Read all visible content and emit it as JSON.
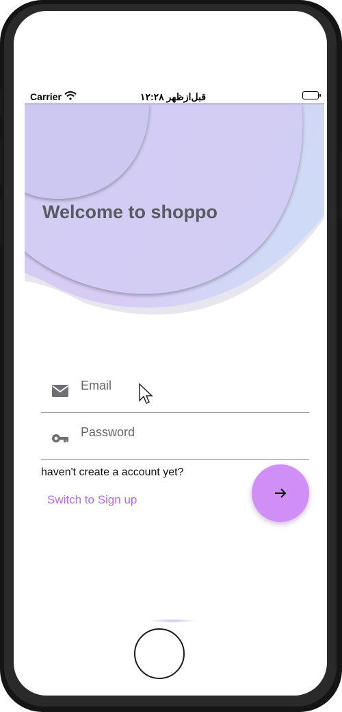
{
  "status_bar": {
    "carrier": "Carrier",
    "time": "۱۲:۲۸ قبل‌ازظهر",
    "wifi_icon": "wifi-icon",
    "battery_icon": "battery-icon"
  },
  "header": {
    "title": "Welcome to shoppo"
  },
  "form": {
    "email": {
      "placeholder": "Email",
      "value": "",
      "icon": "mail-icon"
    },
    "password": {
      "placeholder": "Password",
      "value": "",
      "icon": "key-icon"
    }
  },
  "account": {
    "prompt": "haven't create a account yet?",
    "switch_label": "Switch to Sign up"
  },
  "submit": {
    "icon": "arrow-right-icon"
  },
  "colors": {
    "accent": "#d08ff6",
    "link": "#b46ae8",
    "title": "#5a5a63",
    "header_purple": "#d1cbf4",
    "header_blue": "#cfdcf6"
  }
}
